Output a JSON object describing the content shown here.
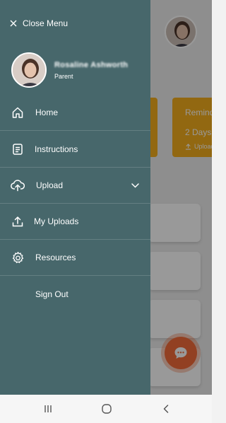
{
  "drawer": {
    "close_label": "Close Menu",
    "profile": {
      "name": "Rosaline Ashworth",
      "role": "Parent"
    },
    "items": [
      {
        "label": "Home",
        "icon": "home-icon"
      },
      {
        "label": "Instructions",
        "icon": "document-icon"
      },
      {
        "label": "Upload",
        "icon": "cloud-upload-icon"
      },
      {
        "label": "My Uploads",
        "icon": "upload-icon"
      },
      {
        "label": "Resources",
        "icon": "gear-icon"
      },
      {
        "label": "Sign Out"
      }
    ]
  },
  "background": {
    "card_reminder_title": "Reminder",
    "card_reminder_days": "2 Days",
    "card_reminder_action": "Upload"
  },
  "colors": {
    "drawer": "#47676b",
    "accent_yellow": "#f3ad1d",
    "fab": "#f36c3a"
  }
}
